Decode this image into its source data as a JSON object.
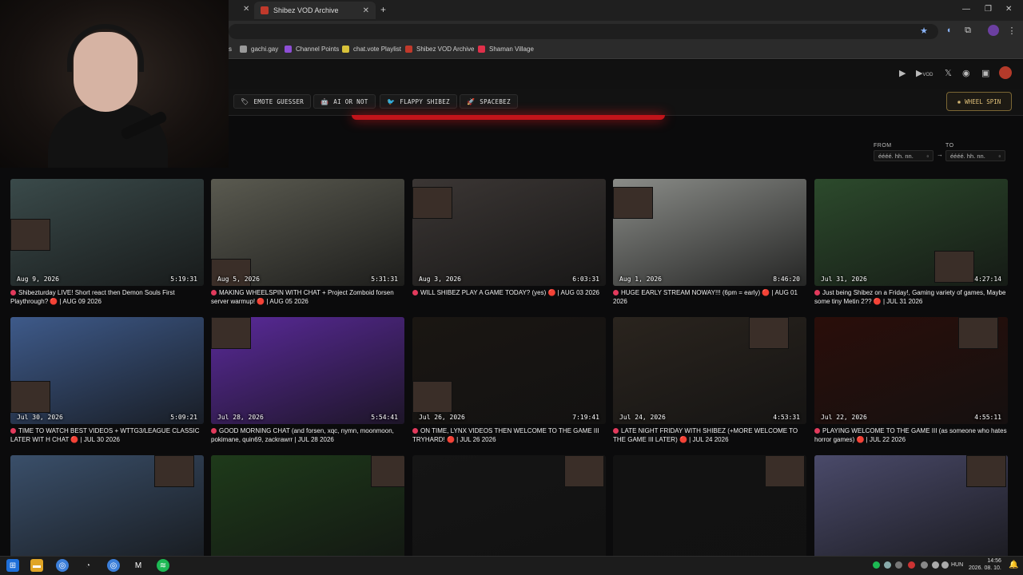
{
  "browser": {
    "tab_title": "Shibez VOD Archive",
    "bookmarks": [
      {
        "label": "gachi.gay",
        "color": "#9a9a9a"
      },
      {
        "label": "Channel Points",
        "color": "#8e4fd6"
      },
      {
        "label": "chat.vote Playlist",
        "color": "#d8c23a"
      },
      {
        "label": "Shibez VOD Archive",
        "color": "#c0392b"
      },
      {
        "label": "Shaman Village",
        "color": "#e0304a"
      }
    ]
  },
  "header": {
    "vod_label": "VOD"
  },
  "tools": [
    {
      "label": "EMOTE GUESSER",
      "icon": "🏷"
    },
    {
      "label": "AI OR NOT",
      "icon": "🤖"
    },
    {
      "label": "FLAPPY SHIBEZ",
      "icon": "🐦"
    },
    {
      "label": "SPACEBEZ",
      "icon": "🚀"
    }
  ],
  "wheel_label": "WHEEL SPIN",
  "filter": {
    "from_label": "FROM",
    "to_label": "TO",
    "from_placeholder": "éééé. hh. nn.",
    "to_placeholder": "éééé. hh. nn."
  },
  "vods": [
    {
      "date": "Aug 9, 2026",
      "duration": "5:19:31",
      "title": "Shibezturday LIVE! Short react then Demon Souls First Playthrough? 🔴 | AUG 09 2026",
      "bg": "#3a4a4a"
    },
    {
      "date": "Aug 5, 2026",
      "duration": "5:31:31",
      "title": "MAKING WHEELSPIN WITH CHAT + Project Zomboid forsen server warmup! 🔴 | AUG 05 2026",
      "bg": "#5a5a50"
    },
    {
      "date": "Aug 3, 2026",
      "duration": "6:03:31",
      "title": "WILL SHIBEZ PLAY A GAME TODAY? (yes) 🔴 | AUG 03 2026",
      "bg": "#3b3634"
    },
    {
      "date": "Aug 1, 2026",
      "duration": "8:46:20",
      "title": "HUGE EARLY STREAM NOWAY!!! (6pm = early) 🔴 | AUG 01 2026",
      "bg": "#8a8c88"
    },
    {
      "date": "Jul 31, 2026",
      "duration": "4:27:14",
      "title": "Just being Shibez on a Friday!, Gaming variety of games, Maybe some tiny Metin 2?? 🔴 | JUL 31 2026",
      "bg": "#2c4a2c"
    },
    {
      "date": "Jul 30, 2026",
      "duration": "5:09:21",
      "title": "TIME TO WATCH BEST VIDEOS + WTTG3/LEAGUE CLASSIC LATER WIT H CHAT 🔴 | JUL 30 2026",
      "bg": "#3e5a8a"
    },
    {
      "date": "Jul 28, 2026",
      "duration": "5:54:41",
      "title": "GOOD MORNING CHAT (and forsen, xqc, nymn, moonmoon, pokimane, quin69, zackrawrr | JUL 28 2026",
      "bg": "#5a2a9a"
    },
    {
      "date": "Jul 26, 2026",
      "duration": "7:19:41",
      "title": "ON TIME, LYNX VIDEOS THEN WELCOME TO THE GAME III TRYHARD! 🔴 | JUL 26 2026",
      "bg": "#1a1612"
    },
    {
      "date": "Jul 24, 2026",
      "duration": "4:53:31",
      "title": "LATE NIGHT FRIDAY WITH SHIBEZ (+MORE WELCOME TO THE GAME III LATER) 🔴 | JUL 24 2026",
      "bg": "#2a241e"
    },
    {
      "date": "Jul 22, 2026",
      "duration": "4:55:11",
      "title": "PLAYING WELCOME TO THE GAME III (as someone who hates horror games) 🔴 | JUL 22 2026",
      "bg": "#2a0e0a"
    },
    {
      "date": "",
      "duration": "",
      "title": "",
      "bg": "#3a4f6a"
    },
    {
      "date": "",
      "duration": "",
      "title": "",
      "bg": "#1e3a1a"
    },
    {
      "date": "",
      "duration": "",
      "title": "",
      "bg": "#151515"
    },
    {
      "date": "",
      "duration": "",
      "title": "",
      "bg": "#121212"
    },
    {
      "date": "",
      "duration": "",
      "title": "",
      "bg": "#4a4a6a"
    }
  ],
  "taskbar": {
    "lang": "HUN",
    "time": "14:56",
    "date": "2026. 08. 10."
  }
}
